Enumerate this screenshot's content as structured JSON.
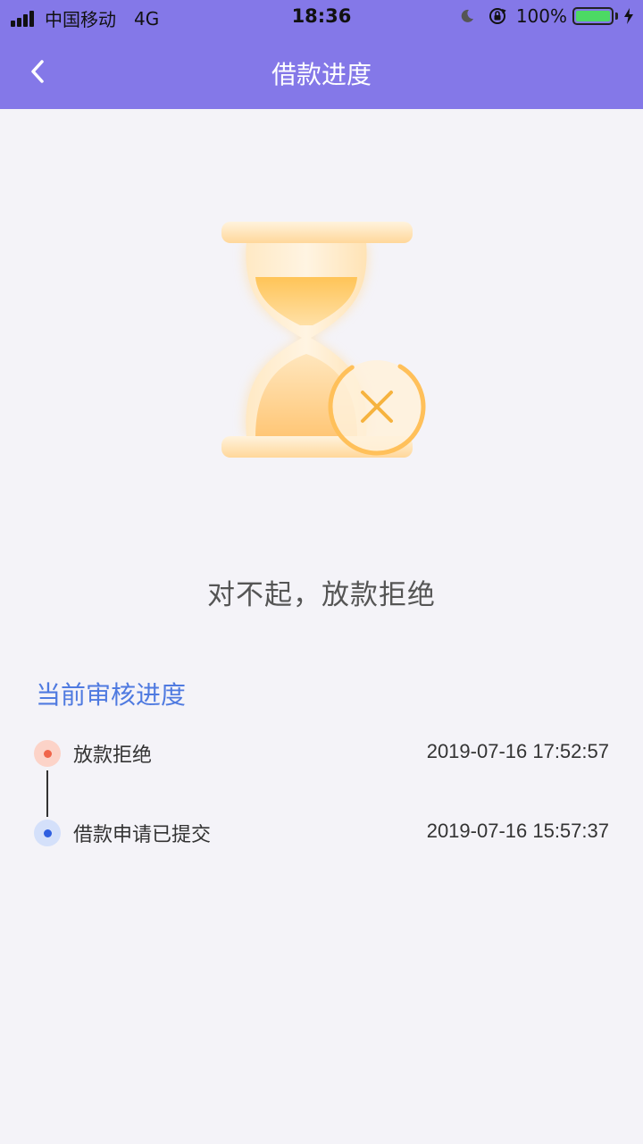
{
  "status_bar": {
    "carrier": "中国移动",
    "network": "4G",
    "time": "18:36",
    "battery": "100%",
    "battery_level": 1.0,
    "battery_color": "#4cd964"
  },
  "nav": {
    "title": "借款进度",
    "back_icon": "chevron-left-icon",
    "background": "#8478e8"
  },
  "result": {
    "icon": "hourglass-rejected-icon",
    "message": "对不起，放款拒绝"
  },
  "progress": {
    "title": "当前审核进度",
    "title_color": "#4f7ae0",
    "steps": [
      {
        "label": "放款拒绝",
        "time": "2019-07-16 17:52:57",
        "dot_color": "#f0654a",
        "halo_color": "#fcd3c8"
      },
      {
        "label": "借款申请已提交",
        "time": "2019-07-16 15:57:37",
        "dot_color": "#2f5fe0",
        "halo_color": "#d4e0fa"
      }
    ]
  }
}
